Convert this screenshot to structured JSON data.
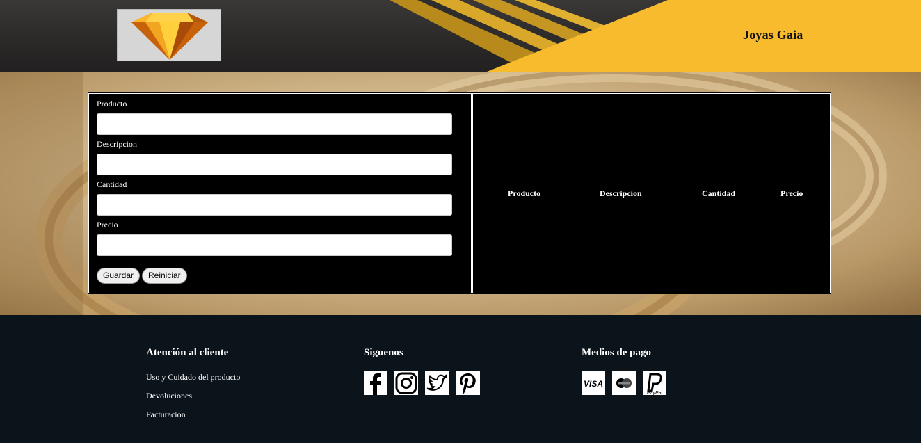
{
  "header": {
    "brand": "Joyas Gaia",
    "logo_icon": "diamond-logo",
    "colors": {
      "dark": "#2b2928",
      "gold": "#f8bb2e",
      "stripe": "#c99a22"
    }
  },
  "form": {
    "fields": [
      {
        "label": "Producto",
        "value": ""
      },
      {
        "label": "Descripcion",
        "value": ""
      },
      {
        "label": "Cantidad",
        "value": ""
      },
      {
        "label": "Precio",
        "value": ""
      }
    ],
    "save_label": "Guardar",
    "reset_label": "Reiniciar"
  },
  "table": {
    "headers": [
      "Producto",
      "Descripcion",
      "Cantidad",
      "Precio"
    ]
  },
  "footer": {
    "customer": {
      "title": "Atención al cliente",
      "links": [
        "Uso y Cuidado del producto",
        "Devoluciones",
        "Facturación"
      ]
    },
    "social": {
      "title": "Siguenos",
      "icons": [
        "facebook-icon",
        "instagram-icon",
        "twitter-icon",
        "pinterest-icon"
      ]
    },
    "payment": {
      "title": "Medios de pago",
      "icons": [
        "visa-icon",
        "mastercard-icon",
        "paypal-icon"
      ]
    }
  }
}
